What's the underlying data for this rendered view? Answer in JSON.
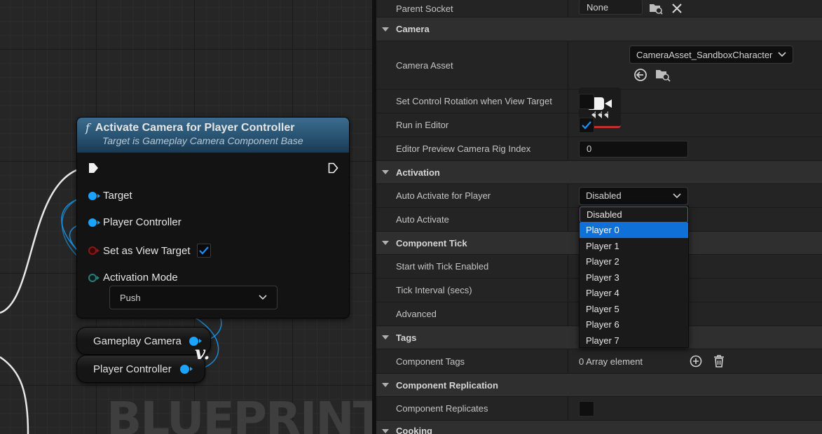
{
  "graph": {
    "watermark": "BLUEPRINT",
    "node": {
      "title": "Activate Camera for Player Controller",
      "subtitle": "Target is Gameplay Camera Component Base",
      "pins": {
        "target": "Target",
        "player_controller": "Player Controller",
        "set_as_view_target": "Set as View Target",
        "activation_mode": "Activation Mode"
      },
      "set_as_view_target_checked": true,
      "activation_mode_value": "Push"
    },
    "variables": {
      "gameplay_camera": "Gameplay Camera",
      "player_controller": "Player Controller",
      "reroute_glyph": "v."
    }
  },
  "details": {
    "parent_socket": {
      "label": "Parent Socket",
      "value": "None"
    },
    "camera": {
      "header": "Camera",
      "camera_asset": {
        "label": "Camera Asset",
        "value": "CameraAsset_SandboxCharacter"
      },
      "set_control_rotation": {
        "label": "Set Control Rotation when View Target",
        "checked": false
      },
      "run_in_editor": {
        "label": "Run in Editor",
        "checked": true
      },
      "preview_rig_index": {
        "label": "Editor Preview Camera Rig Index",
        "value": "0"
      }
    },
    "activation": {
      "header": "Activation",
      "auto_activate_for_player": {
        "label": "Auto Activate for Player",
        "value": "Disabled"
      },
      "auto_activate": {
        "label": "Auto Activate"
      }
    },
    "component_tick": {
      "header": "Component Tick",
      "start_with_tick": {
        "label": "Start with Tick Enabled"
      },
      "tick_interval": {
        "label": "Tick Interval (secs)"
      },
      "advanced": "Advanced"
    },
    "tags": {
      "header": "Tags",
      "component_tags": {
        "label": "Component Tags",
        "value": "0 Array element"
      }
    },
    "replication": {
      "header": "Component Replication",
      "replicates": {
        "label": "Component Replicates",
        "checked": false
      }
    },
    "cooking": {
      "header": "Cooking"
    }
  },
  "dropdown": {
    "options": [
      "Disabled",
      "Player 0",
      "Player 1",
      "Player 2",
      "Player 3",
      "Player 4",
      "Player 5",
      "Player 6",
      "Player 7"
    ],
    "current": "Disabled",
    "highlighted": "Player 0"
  },
  "colors": {
    "accent": "#0f70d7",
    "object_pin": "#1aa3ff",
    "node_header": "#2f5f80",
    "asset_underline": "#c03030"
  }
}
